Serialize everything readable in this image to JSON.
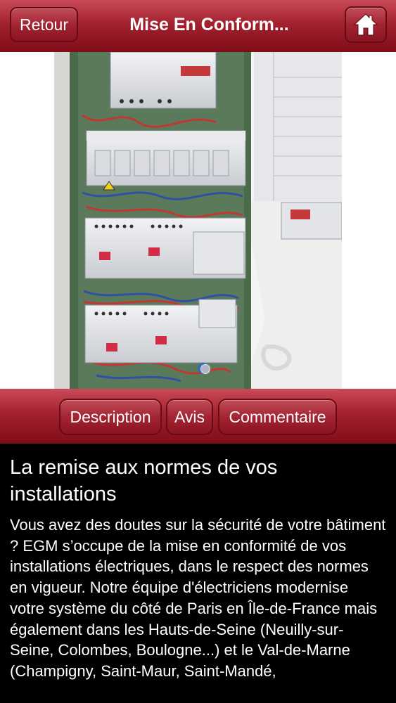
{
  "header": {
    "back_label": "Retour",
    "title": "Mise En Conform...",
    "home_icon": "home-icon"
  },
  "gallery": {
    "image": "electrical-panel-photo",
    "page_indicator_icon": "page-dot-icon"
  },
  "tabs": [
    {
      "label": "Description"
    },
    {
      "label": "Avis"
    },
    {
      "label": "Commentaire"
    }
  ],
  "content": {
    "heading": "La remise aux normes de vos installations",
    "body": "Vous avez des doutes sur la sécurité de votre bâtiment ? EGM s’occupe de la mise en conformité de vos installations électriques, dans le respect des normes en vigueur. Notre équipe d'électriciens modernise votre système du côté de Paris en Île-de-France mais également dans les Hauts-de-Seine (Neuilly-sur-Seine, Colombes, Boulogne...) et le Val-de-Marne (Champigny, Saint-Maur, Saint-Mandé,"
  },
  "colors": {
    "header_red": "#a3212f",
    "header_dark": "#7e0d18",
    "background": "#000000",
    "text": "#ffffff"
  }
}
